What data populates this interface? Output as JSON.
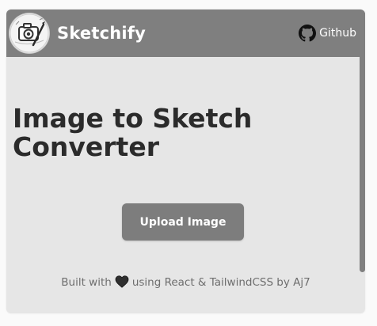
{
  "app": {
    "brand_name": "Sketchify",
    "github_label": "Github"
  },
  "main": {
    "title": "Image to Sketch Converter",
    "upload_label": "Upload Image"
  },
  "footer": {
    "text_before": "Built with",
    "text_after": "using React & TailwindCSS by Aj7"
  },
  "icons": {
    "logo": "camera-sketch-logo-icon",
    "github": "github-icon",
    "heart": "heart-icon"
  },
  "colors": {
    "header_bg": "#7f7f7f",
    "card_bg": "#e6e6e6",
    "button_bg": "#7d7d7d",
    "title_text": "#2b2b2b",
    "footer_text": "#6e6e6e"
  }
}
